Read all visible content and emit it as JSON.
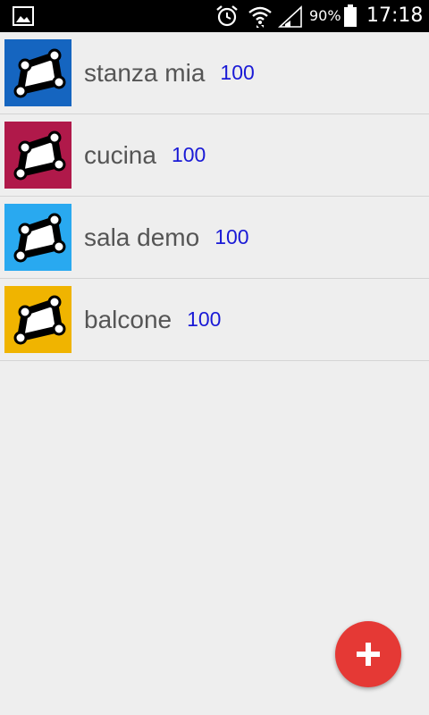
{
  "status_bar": {
    "battery_percent": "90%",
    "time": "17:18",
    "icons": [
      "gallery-icon",
      "alarm-icon",
      "wifi-icon",
      "signal-icon",
      "battery-icon"
    ]
  },
  "rooms": [
    {
      "name": "stanza mia",
      "count": "100",
      "color": "#1565c0"
    },
    {
      "name": "cucina",
      "count": "100",
      "color": "#b0194a"
    },
    {
      "name": "sala demo",
      "count": "100",
      "color": "#29a9f0"
    },
    {
      "name": "balcone",
      "count": "100",
      "color": "#f0b400"
    }
  ],
  "fab": {
    "icon": "plus-icon",
    "color": "#e53935"
  },
  "colors": {
    "background": "#eeeeee",
    "name_text": "#555555",
    "count_text": "#1a1ad6",
    "divider": "#d4d4d4"
  }
}
